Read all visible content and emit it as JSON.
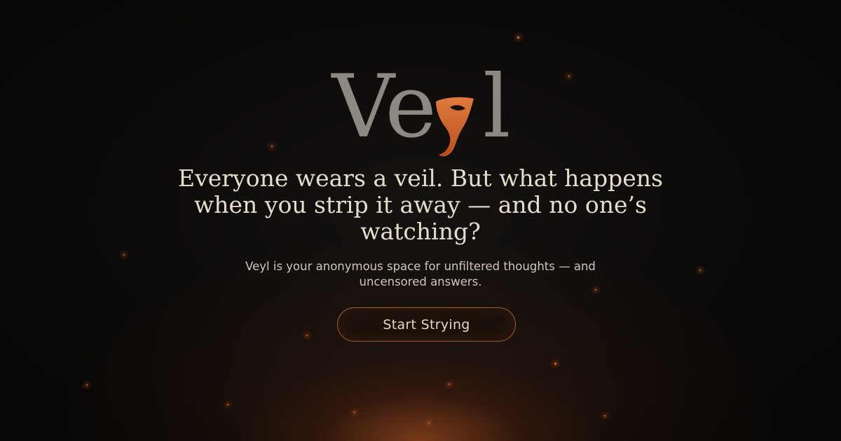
{
  "brand": {
    "name": "Veyl",
    "logo_letters": [
      "Ve",
      "y",
      "l"
    ],
    "accent_color": "#d96a2e"
  },
  "hero": {
    "headline": "Everyone wears a veil. But what happens when you strip it away — and no one’s watching?",
    "subtitle": "Veyl is your anonymous space for unfiltered thoughts — and uncensored answers."
  },
  "cta": {
    "label": "Start Strying"
  },
  "icons": {
    "logo_mask": "theater-mask-icon"
  },
  "colors": {
    "background": "#0d0b0a",
    "logo_text": "#8d8882",
    "headline_text": "#e4dccd",
    "ember": "#d9662a",
    "button_border": "#c47848"
  }
}
